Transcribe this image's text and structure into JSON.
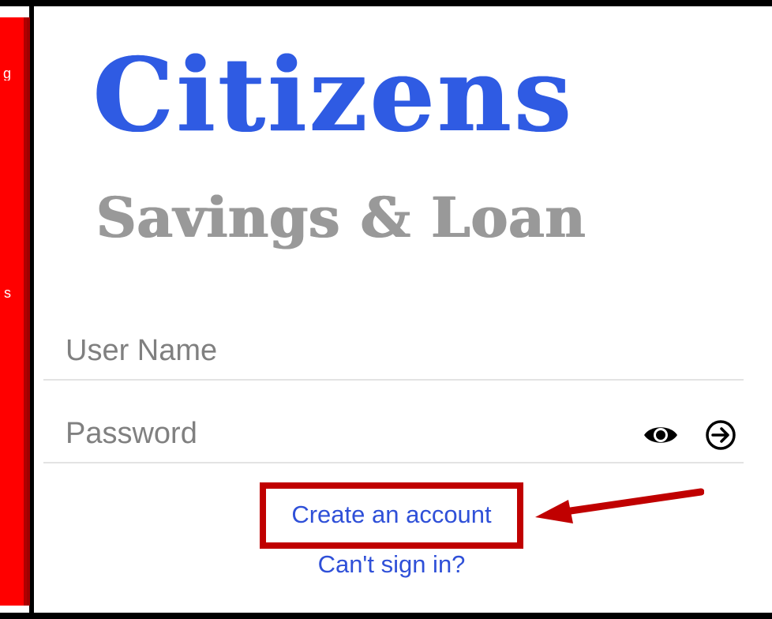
{
  "sidebar": {
    "glyph_top": "g",
    "glyph_mid": "s"
  },
  "logo": {
    "line1": "Citizens",
    "line2": "Savings & Loan"
  },
  "form": {
    "username_placeholder": "User Name",
    "password_placeholder": "Password"
  },
  "links": {
    "create_account": "Create an account",
    "cant_sign_in": "Can't sign in?"
  },
  "icons": {
    "eye": "eye-icon",
    "submit": "arrow-right-circle-icon"
  },
  "colors": {
    "brand_blue": "#2f5be3",
    "brand_gray": "#999999",
    "link_blue": "#2f50d8",
    "highlight_red": "#c00000",
    "sidebar_red": "#ff0000"
  }
}
